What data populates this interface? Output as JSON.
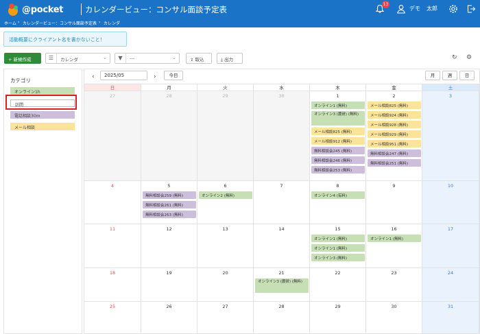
{
  "header": {
    "logo_text": "@pocket",
    "title": "カレンダービュー：コンサル面談予定表",
    "notification_count": "13",
    "user_last": "デモ",
    "user_first": "太郎",
    "icons": [
      "bell-icon",
      "user-icon",
      "gear-icon",
      "logout-icon"
    ]
  },
  "breadcrumb": [
    "ホーム",
    "カレンダービュー：コンサル面談予定表",
    "カレンダ"
  ],
  "notice": "活動概要にクライアント名を書かないこと！",
  "toolbar": {
    "new_label": "+ 新規作成",
    "view_select": "カレンダ",
    "filter_select": "---",
    "import_label": "取込",
    "export_label": "出力"
  },
  "sidebar": {
    "title": "カテゴリ",
    "categories": [
      {
        "label": "オンライン1h",
        "color": "#c6dfb4"
      },
      {
        "label": "訪問",
        "color": "#ffffff"
      },
      {
        "label": "電話相談30m",
        "color": "#cdbfdc"
      },
      {
        "label": "メール相談",
        "color": "#fbe39a"
      }
    ]
  },
  "calendar": {
    "current": "2025/05",
    "today_label": "今日",
    "views": [
      "月",
      "週",
      "日"
    ],
    "weekdays": [
      "日",
      "月",
      "火",
      "水",
      "木",
      "金",
      "土"
    ],
    "weeks": [
      [
        "27",
        "28",
        "29",
        "30",
        "1",
        "2",
        "3"
      ],
      [
        "4",
        "5",
        "6",
        "7",
        "8",
        "9",
        "10"
      ],
      [
        "11",
        "12",
        "13",
        "14",
        "15",
        "16",
        "17"
      ],
      [
        "18",
        "19",
        "20",
        "21",
        "22",
        "23",
        "24"
      ],
      [
        "25",
        "26",
        "27",
        "28",
        "29",
        "30",
        "31"
      ]
    ],
    "events": {
      "w0d4": [
        "オンライン1 (無料)",
        "オンライン3 (農研) (無料)",
        "メール相談825 (無料)",
        "メール相談912 (無料)",
        "無料相談会245 (無料)",
        "無料相談会246 (無料)",
        "無料相談会253 (無料)"
      ],
      "w0d5": [
        "メール相談825 (無料)",
        "メール相談924 (無料)",
        "メール相談928 (無料)",
        "メール相談929 (無料)",
        "メール相談951 (無料)",
        "無料相談会247 (無料)",
        "無料相談会251 (無料)"
      ],
      "w1d1": [
        "無料相談会259 (無料)",
        "無料相談会261 (無料)",
        "無料相談会263 (無料)"
      ],
      "w1d2": [
        "オンライン2 (無料)"
      ],
      "w1d4": [
        "オンライン4 (有料)"
      ],
      "w2d4": [
        "オンライン1 (無料)",
        "オンライン1 (無料)",
        "オンライン3 (無料)"
      ],
      "w2d5": [
        "オンライン1 (無料)"
      ],
      "w3d3": [
        "オンライン3 (農研) (無料)"
      ]
    }
  }
}
